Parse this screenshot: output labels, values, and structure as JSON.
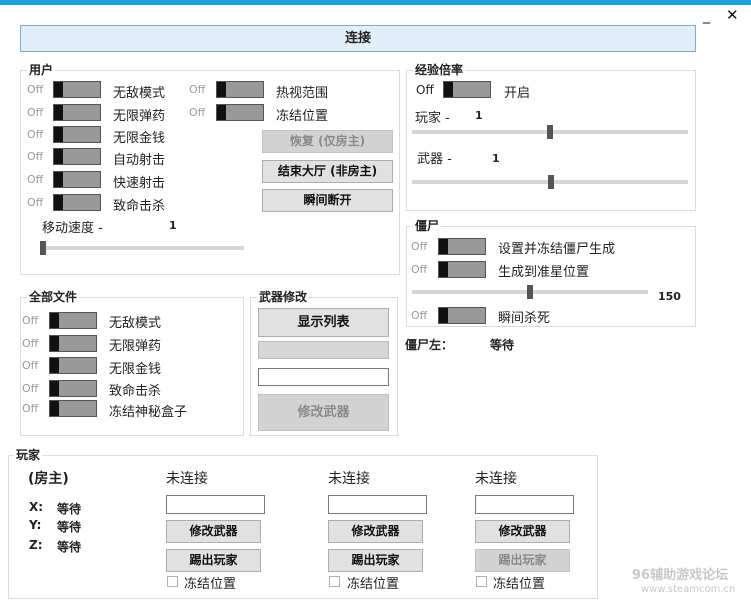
{
  "window": {
    "minimize": "_",
    "close": "✕"
  },
  "connect_label": "连接",
  "user": {
    "title": "用户",
    "off": "Off",
    "toggles_left": [
      "无敌模式",
      "无限弹药",
      "无限金钱",
      "自动射击",
      "快速射击",
      "致命击杀"
    ],
    "toggles_right": [
      "热视范围",
      "冻结位置"
    ],
    "buttons": [
      "恢复 (仅房主)",
      "结束大厅 (非房主)",
      "瞬间断开"
    ],
    "speed_label": "移动速度 -",
    "speed_value": "1"
  },
  "exp": {
    "title": "经验倍率",
    "off": "Off",
    "enable": "开启",
    "player_label": "玩家 -",
    "player_value": "1",
    "weapon_label": "武器 -",
    "weapon_value": "1"
  },
  "zombie": {
    "title": "僵尸",
    "off": "Off",
    "freeze_spawn": "设置并冻结僵尸生成",
    "spawn_crosshair": "生成到准星位置",
    "slider_value": "150",
    "instant_kill": "瞬间杀死"
  },
  "zombies_left": {
    "label": "僵尸左：",
    "value": "等待"
  },
  "all": {
    "title": "全部文件",
    "off": "Off",
    "toggles": [
      "无敌模式",
      "无限弹药",
      "无限金钱",
      "致命击杀",
      "冻结神秘盒子"
    ]
  },
  "weapon": {
    "title": "武器修改",
    "show_list": "显示列表",
    "modify": "修改武器"
  },
  "players": {
    "title": "玩家",
    "host": "(房主)",
    "x_label": "X:",
    "y_label": "Y:",
    "z_label": "Z:",
    "x_value": "等待",
    "y_value": "等待",
    "z_value": "等待",
    "slots": [
      {
        "status": "未连接",
        "modify": "修改武器",
        "kick": "踢出玩家",
        "freeze": "冻结位置"
      },
      {
        "status": "未连接",
        "modify": "修改武器",
        "kick": "踢出玩家",
        "freeze": "冻结位置"
      },
      {
        "status": "未连接",
        "modify": "修改武器",
        "kick": "踢出玩家",
        "freeze": "冻结位置"
      }
    ]
  },
  "watermark": {
    "line1": "96辅助游戏论坛",
    "line2": "www.steamcom.cn"
  }
}
